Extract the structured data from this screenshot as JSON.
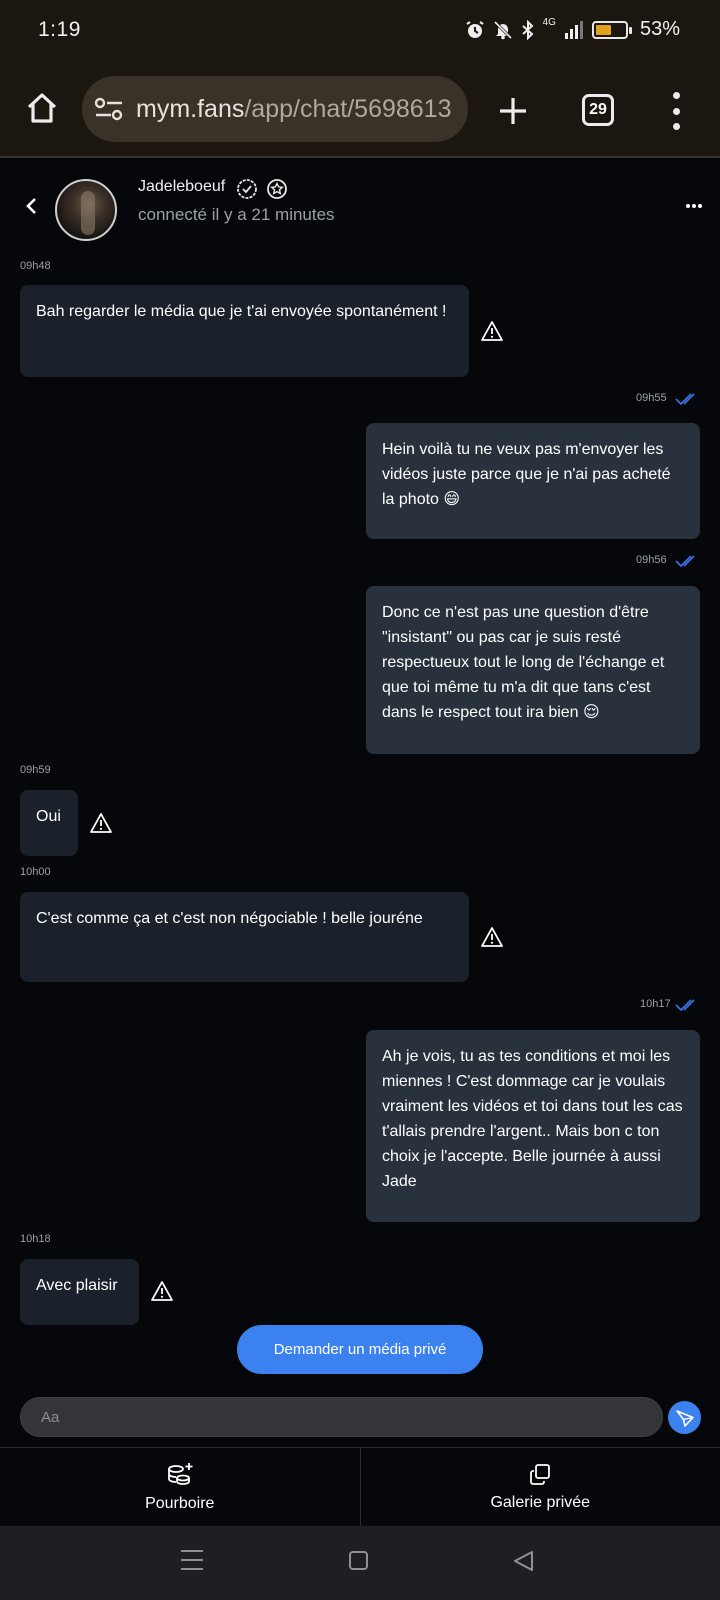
{
  "status_bar": {
    "time": "1:19",
    "network": "4G",
    "battery_percent": "53%",
    "battery_level": 0.53
  },
  "browser": {
    "url_domain": "mym.fans",
    "url_path": "/app/chat/5698613",
    "tab_count": "29"
  },
  "chat_header": {
    "name": "Jadeleboeuf",
    "status": "connecté il y a 21 minutes"
  },
  "messages": [
    {
      "time": "09h48",
      "text": "Bah regarder le média que je t'ai envoyée spontanément !"
    },
    {
      "time": "09h55",
      "text": "Hein voilà tu ne veux pas m'envoyer les vidéos juste parce que je n'ai pas acheté la photo 😄"
    },
    {
      "time": "09h56",
      "text": "Donc ce n'est pas une question d'être \"insistant\" ou pas car je suis resté respectueux tout le long de l'échange et que toi même tu m'a dit que tans c'est dans le respect tout ira bien 😌"
    },
    {
      "time": "09h59",
      "text": "Oui"
    },
    {
      "time": "10h00",
      "text": "C'est comme ça et c'est non négociable ! belle jouréne"
    },
    {
      "time": "10h17",
      "text": "Ah je vois, tu as tes conditions et moi les miennes ! C'est dommage car je voulais vraiment les vidéos et toi dans tout les cas t'allais prendre l'argent.. Mais bon c ton choix je l'accepte. Belle journée à aussi Jade"
    },
    {
      "time": "10h18",
      "text": "Avec plaisir"
    }
  ],
  "request_button": "Demander un média privé",
  "composer": {
    "placeholder": "Aa"
  },
  "actions": {
    "tip": "Pourboire",
    "gallery": "Galerie privée"
  },
  "colors": {
    "accent": "#3b82f0",
    "incoming_bubble": "#1b212a",
    "outgoing_bubble": "#29313d",
    "read_ticks": "#3b6fe0"
  }
}
